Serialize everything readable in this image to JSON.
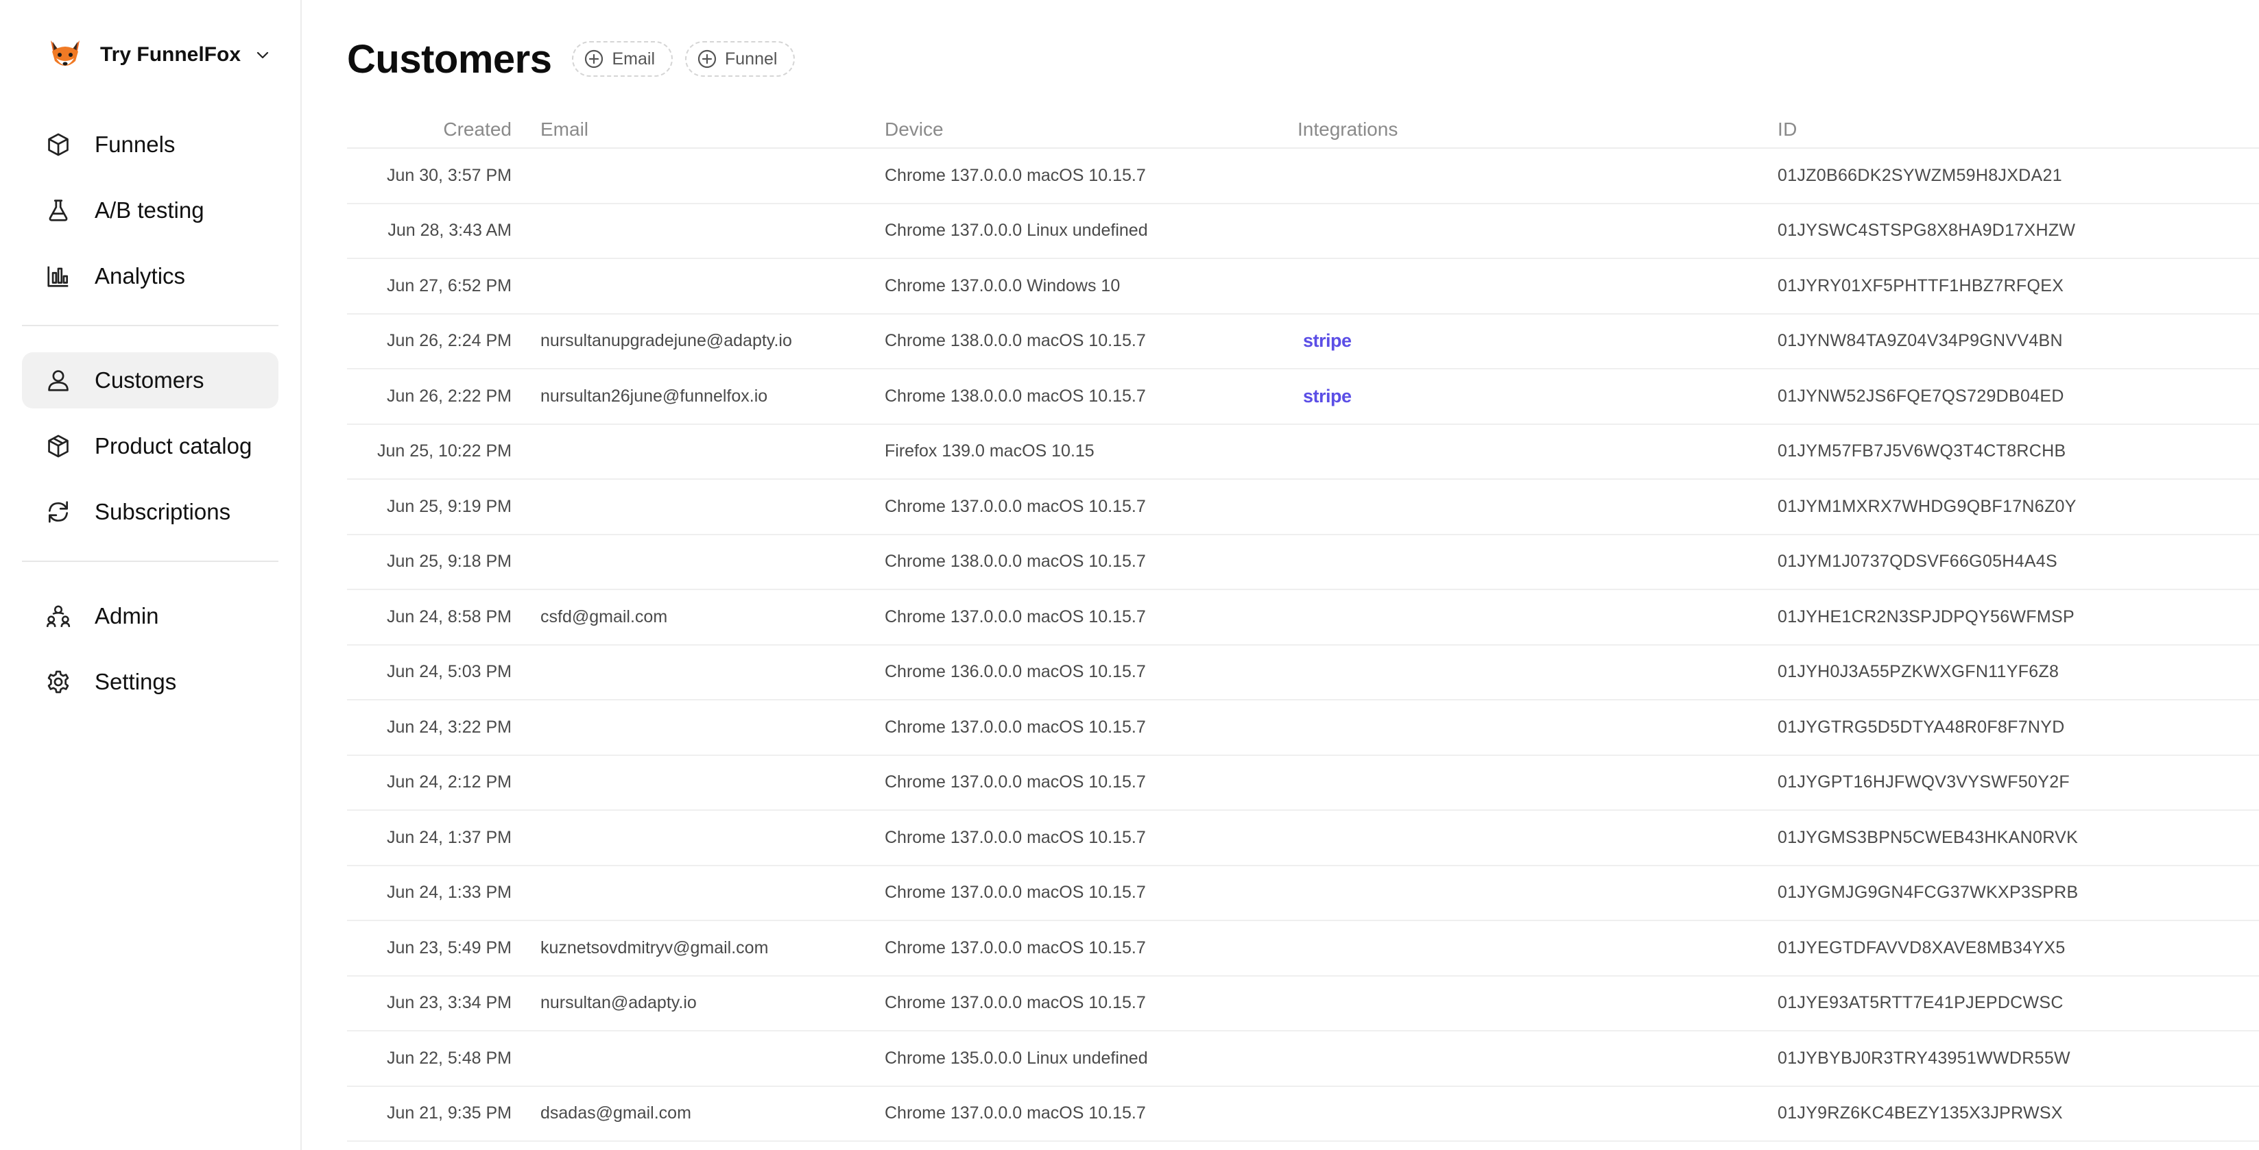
{
  "brand": {
    "name": "Try FunnelFox"
  },
  "nav": {
    "funnels": "Funnels",
    "ab_testing": "A/B testing",
    "analytics": "Analytics",
    "customers": "Customers",
    "product_catalog": "Product catalog",
    "subscriptions": "Subscriptions",
    "admin": "Admin",
    "settings": "Settings"
  },
  "page": {
    "title": "Customers"
  },
  "filters": {
    "email": "Email",
    "funnel": "Funnel"
  },
  "table": {
    "headers": {
      "created": "Created",
      "email": "Email",
      "device": "Device",
      "integrations": "Integrations",
      "id": "ID"
    },
    "rows": [
      {
        "created": "Jun 30, 3:57 PM",
        "email": "",
        "device": "Chrome 137.0.0.0 macOS 10.15.7",
        "integration": "",
        "id": "01JZ0B66DK2SYWZM59H8JXDA21"
      },
      {
        "created": "Jun 28, 3:43 AM",
        "email": "",
        "device": "Chrome 137.0.0.0 Linux undefined",
        "integration": "",
        "id": "01JYSWC4STSPG8X8HA9D17XHZW"
      },
      {
        "created": "Jun 27, 6:52 PM",
        "email": "",
        "device": "Chrome 137.0.0.0 Windows 10",
        "integration": "",
        "id": "01JYRY01XF5PHTTF1HBZ7RFQEX"
      },
      {
        "created": "Jun 26, 2:24 PM",
        "email": "nursultanupgradejune@adapty.io",
        "device": "Chrome 138.0.0.0 macOS 10.15.7",
        "integration": "stripe",
        "id": "01JYNW84TA9Z04V34P9GNVV4BN"
      },
      {
        "created": "Jun 26, 2:22 PM",
        "email": "nursultan26june@funnelfox.io",
        "device": "Chrome 138.0.0.0 macOS 10.15.7",
        "integration": "stripe",
        "id": "01JYNW52JS6FQE7QS729DB04ED"
      },
      {
        "created": "Jun 25, 10:22 PM",
        "email": "",
        "device": "Firefox 139.0 macOS 10.15",
        "integration": "",
        "id": "01JYM57FB7J5V6WQ3T4CT8RCHB"
      },
      {
        "created": "Jun 25, 9:19 PM",
        "email": "",
        "device": "Chrome 137.0.0.0 macOS 10.15.7",
        "integration": "",
        "id": "01JYM1MXRX7WHDG9QBF17N6Z0Y"
      },
      {
        "created": "Jun 25, 9:18 PM",
        "email": "",
        "device": "Chrome 138.0.0.0 macOS 10.15.7",
        "integration": "",
        "id": "01JYM1J0737QDSVF66G05H4A4S"
      },
      {
        "created": "Jun 24, 8:58 PM",
        "email": "csfd@gmail.com",
        "device": "Chrome 137.0.0.0 macOS 10.15.7",
        "integration": "",
        "id": "01JYHE1CR2N3SPJDPQY56WFMSP"
      },
      {
        "created": "Jun 24, 5:03 PM",
        "email": "",
        "device": "Chrome 136.0.0.0 macOS 10.15.7",
        "integration": "",
        "id": "01JYH0J3A55PZKWXGFN11YF6Z8"
      },
      {
        "created": "Jun 24, 3:22 PM",
        "email": "",
        "device": "Chrome 137.0.0.0 macOS 10.15.7",
        "integration": "",
        "id": "01JYGTRG5D5DTYA48R0F8F7NYD"
      },
      {
        "created": "Jun 24, 2:12 PM",
        "email": "",
        "device": "Chrome 137.0.0.0 macOS 10.15.7",
        "integration": "",
        "id": "01JYGPT16HJFWQV3VYSWF50Y2F"
      },
      {
        "created": "Jun 24, 1:37 PM",
        "email": "",
        "device": "Chrome 137.0.0.0 macOS 10.15.7",
        "integration": "",
        "id": "01JYGMS3BPN5CWEB43HKAN0RVK"
      },
      {
        "created": "Jun 24, 1:33 PM",
        "email": "",
        "device": "Chrome 137.0.0.0 macOS 10.15.7",
        "integration": "",
        "id": "01JYGMJG9GN4FCG37WKXP3SPRB"
      },
      {
        "created": "Jun 23, 5:49 PM",
        "email": "kuznetsovdmitryv@gmail.com",
        "device": "Chrome 137.0.0.0 macOS 10.15.7",
        "integration": "",
        "id": "01JYEGTDFAVVD8XAVE8MB34YX5"
      },
      {
        "created": "Jun 23, 3:34 PM",
        "email": "nursultan@adapty.io",
        "device": "Chrome 137.0.0.0 macOS 10.15.7",
        "integration": "",
        "id": "01JYE93AT5RTT7E41PJEPDCWSC"
      },
      {
        "created": "Jun 22, 5:48 PM",
        "email": "",
        "device": "Chrome 135.0.0.0 Linux undefined",
        "integration": "",
        "id": "01JYBYBJ0R3TRY43951WWDR55W"
      },
      {
        "created": "Jun 21, 9:35 PM",
        "email": "dsadas@gmail.com",
        "device": "Chrome 137.0.0.0 macOS 10.15.7",
        "integration": "",
        "id": "01JY9RZ6KC4BEZY135X3JPRWSX"
      }
    ]
  },
  "icons": {
    "brand": "fox-logo-icon",
    "funnels": "cube-icon",
    "ab_testing": "flask-icon",
    "analytics": "bar-chart-icon",
    "customers": "user-icon",
    "product_catalog": "package-icon",
    "subscriptions": "refresh-icon",
    "admin": "users-admin-icon",
    "settings": "gear-icon"
  },
  "colors": {
    "stripe": "#5b4ee6",
    "active_nav_bg": "#f1f1f1"
  }
}
